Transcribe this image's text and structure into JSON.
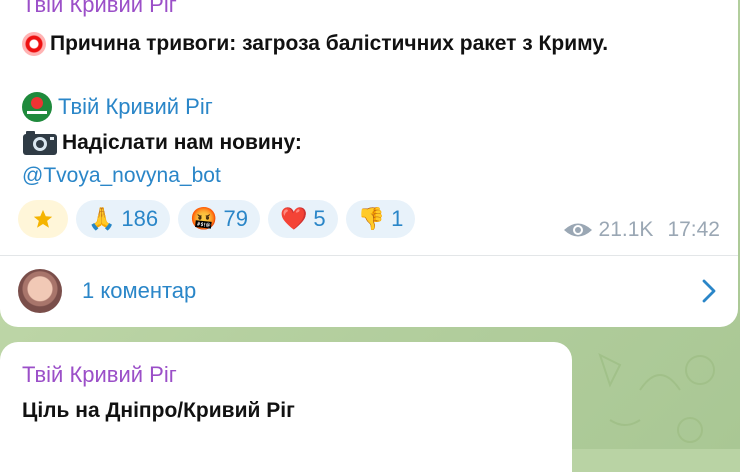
{
  "post": {
    "sender": "Твій Кривий Ріг",
    "alert_text": "Причина тривоги: загроза балістичних ракет з Криму.",
    "channel_link": "Твій Кривий Ріг",
    "send_news_text": "Надіслати нам новину:",
    "bot_link": "@Tvoya_novyna_bot",
    "reactions": [
      {
        "emoji": "star",
        "count": ""
      },
      {
        "emoji": "🙏",
        "count": "186"
      },
      {
        "emoji": "🤬",
        "count": "79"
      },
      {
        "emoji": "❤️",
        "count": "5"
      },
      {
        "emoji": "👎",
        "count": "1"
      }
    ],
    "views": "21.1K",
    "time": "17:42",
    "comments_label": "1 коментар"
  },
  "next_post": {
    "sender": "Твій Кривий Ріг",
    "text": "Ціль на Дніпро/Кривий Ріг"
  },
  "colors": {
    "sender": "#9b4fc8",
    "link": "#2a86c8",
    "meta": "#9aa7b4",
    "wallpaper": "#b9d3a4"
  }
}
